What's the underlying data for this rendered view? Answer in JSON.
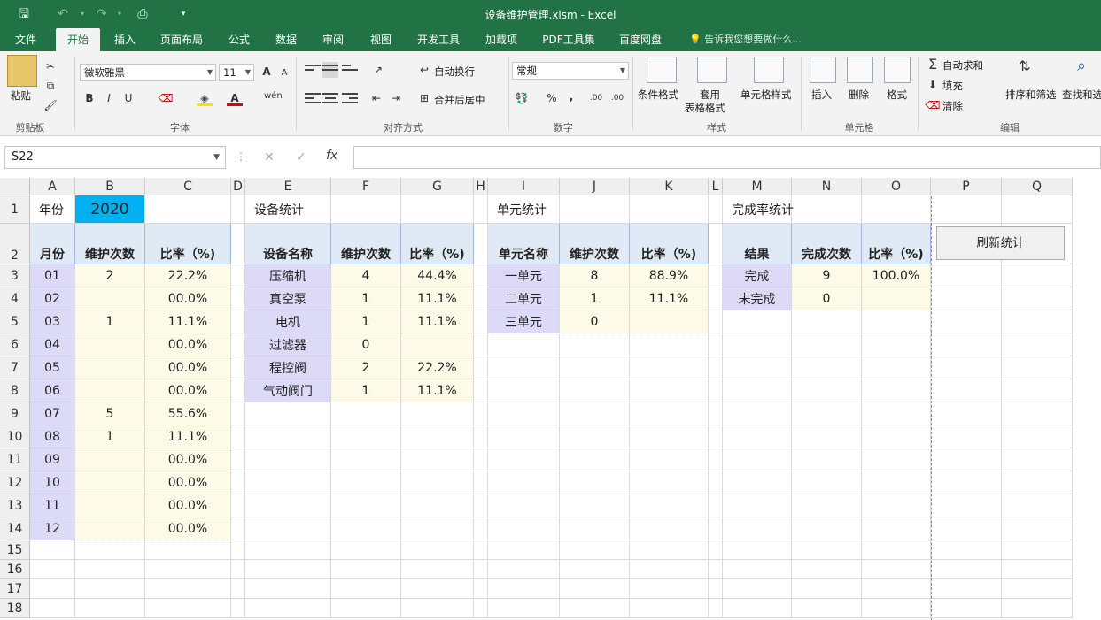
{
  "window": {
    "title": "设备维护管理.xlsm - Excel"
  },
  "quick_access": {
    "save": "save-icon",
    "undo": "undo-icon",
    "redo": "redo-icon",
    "preview": "print-preview-icon",
    "customize": "customize-icon"
  },
  "tabs": [
    {
      "label": "文件"
    },
    {
      "label": "开始"
    },
    {
      "label": "插入"
    },
    {
      "label": "页面布局"
    },
    {
      "label": "公式"
    },
    {
      "label": "数据"
    },
    {
      "label": "审阅"
    },
    {
      "label": "视图"
    },
    {
      "label": "开发工具"
    },
    {
      "label": "加载项"
    },
    {
      "label": "PDF工具集"
    },
    {
      "label": "百度网盘"
    }
  ],
  "tell_me": "告诉我您想要做什么...",
  "ribbon": {
    "clipboard": {
      "paste": "粘贴",
      "group": "剪贴板"
    },
    "font": {
      "name": "微软雅黑",
      "size": "11",
      "bold": "B",
      "italic": "I",
      "underline": "U",
      "grow": "A",
      "shrink": "A",
      "group": "字体"
    },
    "alignment": {
      "wrap": "自动换行",
      "merge": "合并后居中",
      "group": "对齐方式"
    },
    "number": {
      "format": "常规",
      "percent": "%",
      "comma": ",",
      "inc": ".00",
      "dec": ".00",
      "group": "数字"
    },
    "styles": {
      "conditional": "条件格式",
      "table_1": "套用",
      "table_2": "表格格式",
      "cell_styles": "单元格样式",
      "group": "样式"
    },
    "cells": {
      "insert": "插入",
      "delete": "删除",
      "format": "格式",
      "group": "单元格"
    },
    "editing": {
      "autosum": "自动求和",
      "fill": "填充",
      "clear": "清除",
      "sort": "排序和筛选",
      "find": "查找和选",
      "group": "编辑"
    }
  },
  "formula_bar": {
    "name_box": "S22",
    "cancel": "✕",
    "enter": "✓",
    "fx": "fx",
    "content": ""
  },
  "columns": [
    "A",
    "B",
    "C",
    "D",
    "E",
    "F",
    "G",
    "H",
    "I",
    "J",
    "K",
    "L",
    "M",
    "N",
    "O",
    "P",
    "Q"
  ],
  "rows": [
    "1",
    "2",
    "3",
    "4",
    "5",
    "6",
    "7",
    "8",
    "9",
    "10",
    "11",
    "12",
    "13",
    "14",
    "15",
    "16",
    "17",
    "18"
  ],
  "sheet": {
    "year_label": "年份",
    "year": "2020",
    "monthly": {
      "headers": [
        "月份",
        "维护次数",
        "比率（%)"
      ],
      "rows": [
        [
          "01",
          "2",
          "22.2%"
        ],
        [
          "02",
          "",
          "00.0%"
        ],
        [
          "03",
          "1",
          "11.1%"
        ],
        [
          "04",
          "",
          "00.0%"
        ],
        [
          "05",
          "",
          "00.0%"
        ],
        [
          "06",
          "",
          "00.0%"
        ],
        [
          "07",
          "5",
          "55.6%"
        ],
        [
          "08",
          "1",
          "11.1%"
        ],
        [
          "09",
          "",
          "00.0%"
        ],
        [
          "10",
          "",
          "00.0%"
        ],
        [
          "11",
          "",
          "00.0%"
        ],
        [
          "12",
          "",
          "00.0%"
        ]
      ]
    },
    "equipment": {
      "title": "设备统计",
      "headers": [
        "设备名称",
        "维护次数",
        "比率（%)"
      ],
      "rows": [
        [
          "压缩机",
          "4",
          "44.4%"
        ],
        [
          "真空泵",
          "1",
          "11.1%"
        ],
        [
          "电机",
          "1",
          "11.1%"
        ],
        [
          "过滤器",
          "0",
          ""
        ],
        [
          "程控阀",
          "2",
          "22.2%"
        ],
        [
          "气动阀门",
          "1",
          "11.1%"
        ]
      ]
    },
    "units": {
      "title": "单元统计",
      "headers": [
        "单元名称",
        "维护次数",
        "比率（%)"
      ],
      "rows": [
        [
          "一单元",
          "8",
          "88.9%"
        ],
        [
          "二单元",
          "1",
          "11.1%"
        ],
        [
          "三单元",
          "0",
          ""
        ]
      ]
    },
    "completion": {
      "title": "完成率统计",
      "headers": [
        "结果",
        "完成次数",
        "比率（%)"
      ],
      "rows": [
        [
          "完成",
          "9",
          "100.0%"
        ],
        [
          "未完成",
          "0",
          ""
        ]
      ]
    },
    "refresh_button": "刷新统计"
  }
}
